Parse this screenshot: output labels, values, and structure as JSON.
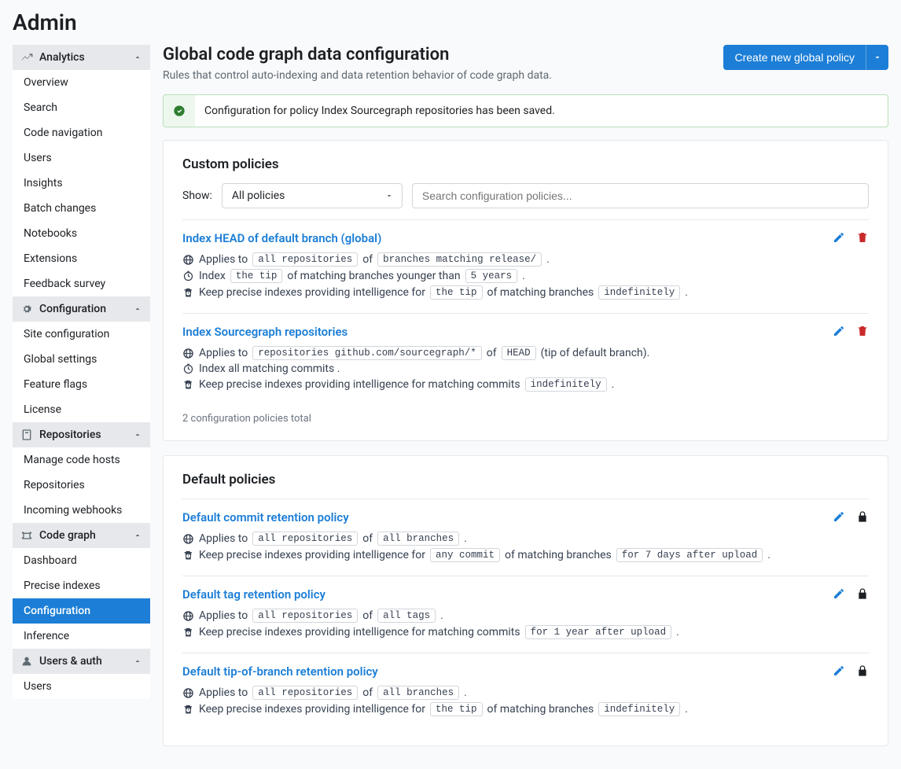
{
  "page_title": "Admin",
  "header": {
    "title": "Global code graph data configuration",
    "subtitle": "Rules that control auto-indexing and data retention behavior of code graph data.",
    "create_button": "Create new global policy"
  },
  "alert": {
    "message": "Configuration for policy Index Sourcegraph repositories has been saved."
  },
  "sidebar": {
    "analytics": {
      "label": "Analytics",
      "items": [
        "Overview",
        "Search",
        "Code navigation",
        "Users",
        "Insights",
        "Batch changes",
        "Notebooks",
        "Extensions",
        "Feedback survey"
      ]
    },
    "configuration": {
      "label": "Configuration",
      "items": [
        "Site configuration",
        "Global settings",
        "Feature flags",
        "License"
      ]
    },
    "repositories": {
      "label": "Repositories",
      "items": [
        "Manage code hosts",
        "Repositories",
        "Incoming webhooks"
      ]
    },
    "codegraph": {
      "label": "Code graph",
      "items": [
        "Dashboard",
        "Precise indexes",
        "Configuration",
        "Inference"
      ],
      "active": "Configuration"
    },
    "users_auth": {
      "label": "Users & auth",
      "items": [
        "Users"
      ]
    }
  },
  "custom": {
    "heading": "Custom policies",
    "show_label": "Show:",
    "select_value": "All policies",
    "search_placeholder": "Search configuration policies...",
    "count_text": "2 configuration policies total",
    "policies": [
      {
        "title": "Index HEAD of default branch (global)",
        "lines": [
          {
            "icon": "web",
            "parts": [
              "Applies to ",
              {
                "tag": "all repositories"
              },
              " of ",
              {
                "tag": "branches matching release/"
              },
              " ."
            ]
          },
          {
            "icon": "timer",
            "parts": [
              "Index ",
              {
                "tag": "the tip"
              },
              " of matching branches younger than ",
              {
                "tag": "5 years"
              },
              " ."
            ]
          },
          {
            "icon": "trash-clock",
            "parts": [
              "Keep precise indexes providing intelligence for ",
              {
                "tag": "the tip"
              },
              " of matching branches ",
              {
                "tag": "indefinitely"
              },
              " ."
            ]
          }
        ],
        "actions": [
          "edit",
          "delete"
        ]
      },
      {
        "title": "Index Sourcegraph repositories",
        "lines": [
          {
            "icon": "web",
            "parts": [
              "Applies to ",
              {
                "tag": "repositories github.com/sourcegraph/*"
              },
              " of ",
              {
                "tag": "HEAD"
              },
              " (tip of default branch)."
            ]
          },
          {
            "icon": "timer",
            "parts": [
              "Index all matching commits ."
            ]
          },
          {
            "icon": "trash-clock",
            "parts": [
              "Keep precise indexes providing intelligence for matching commits ",
              {
                "tag": "indefinitely"
              },
              " ."
            ]
          }
        ],
        "actions": [
          "edit",
          "delete"
        ]
      }
    ]
  },
  "default": {
    "heading": "Default policies",
    "policies": [
      {
        "title": "Default commit retention policy",
        "lines": [
          {
            "icon": "web",
            "parts": [
              "Applies to ",
              {
                "tag": "all repositories"
              },
              " of ",
              {
                "tag": "all branches"
              },
              " ."
            ]
          },
          {
            "icon": "trash-clock",
            "parts": [
              "Keep precise indexes providing intelligence for ",
              {
                "tag": "any commit"
              },
              " of matching branches ",
              {
                "tag": "for 7 days after upload"
              },
              " ."
            ]
          }
        ],
        "actions": [
          "edit",
          "lock"
        ]
      },
      {
        "title": "Default tag retention policy",
        "lines": [
          {
            "icon": "web",
            "parts": [
              "Applies to ",
              {
                "tag": "all repositories"
              },
              " of ",
              {
                "tag": "all tags"
              },
              " ."
            ]
          },
          {
            "icon": "trash-clock",
            "parts": [
              "Keep precise indexes providing intelligence for matching commits ",
              {
                "tag": "for 1 year after upload"
              },
              " ."
            ]
          }
        ],
        "actions": [
          "edit",
          "lock"
        ]
      },
      {
        "title": "Default tip-of-branch retention policy",
        "lines": [
          {
            "icon": "web",
            "parts": [
              "Applies to ",
              {
                "tag": "all repositories"
              },
              " of ",
              {
                "tag": "all branches"
              },
              " ."
            ]
          },
          {
            "icon": "trash-clock",
            "parts": [
              "Keep precise indexes providing intelligence for ",
              {
                "tag": "the tip"
              },
              " of matching branches ",
              {
                "tag": "indefinitely"
              },
              " ."
            ]
          }
        ],
        "actions": [
          "edit",
          "lock"
        ]
      }
    ]
  }
}
